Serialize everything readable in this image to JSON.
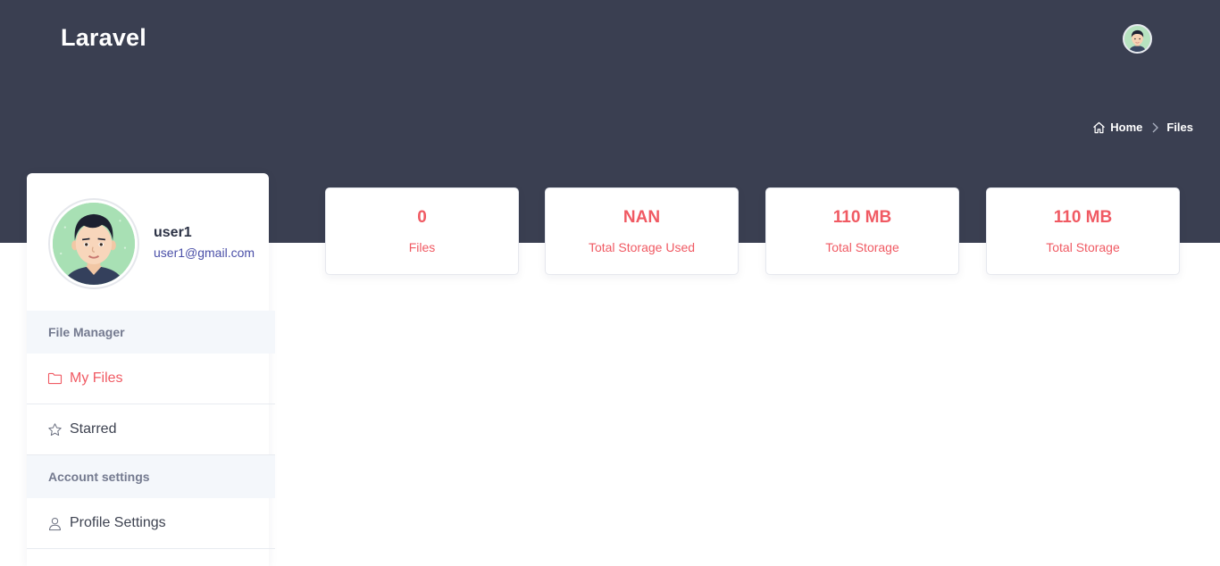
{
  "header": {
    "brand": "Laravel",
    "avatar_icon": "user-avatar"
  },
  "breadcrumb": {
    "home": "Home",
    "current": "Files"
  },
  "profile": {
    "name": "user1",
    "email": "user1@gmail.com"
  },
  "sidebar": {
    "sections": [
      {
        "title": "File Manager",
        "items": [
          {
            "label": "My Files",
            "icon": "folder-icon",
            "active": true
          },
          {
            "label": "Starred",
            "icon": "star-icon",
            "active": false
          }
        ]
      },
      {
        "title": "Account settings",
        "items": [
          {
            "label": "Profile Settings",
            "icon": "user-icon",
            "active": false
          }
        ]
      }
    ]
  },
  "stats": [
    {
      "value": "0",
      "label": "Files"
    },
    {
      "value": "NAN",
      "label": "Total Storage Used"
    },
    {
      "value": "110 MB",
      "label": "Total Storage"
    },
    {
      "value": "110 MB",
      "label": "Total Storage"
    }
  ],
  "colors": {
    "header_bg": "#3a3f51",
    "accent": "#f05a63",
    "email": "#4a4fa8"
  }
}
